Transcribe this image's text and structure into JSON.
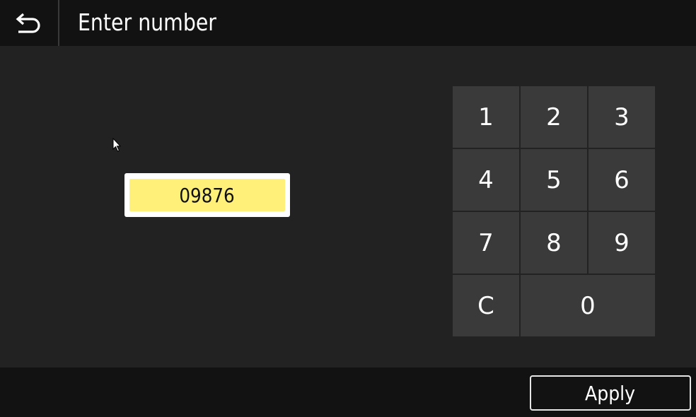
{
  "header": {
    "back_icon": "back-arrow-icon",
    "title": "Enter number"
  },
  "number_input": {
    "value": "09876"
  },
  "keypad": {
    "keys": {
      "k1": "1",
      "k2": "2",
      "k3": "3",
      "k4": "4",
      "k5": "5",
      "k6": "6",
      "k7": "7",
      "k8": "8",
      "k9": "9",
      "clear": "C",
      "k0": "0"
    }
  },
  "footer": {
    "apply_label": "Apply"
  },
  "colors": {
    "background": "#222222",
    "bar": "#121212",
    "key": "#3a3a3a",
    "input_highlight": "#fff07a",
    "input_border": "#ffffff"
  }
}
